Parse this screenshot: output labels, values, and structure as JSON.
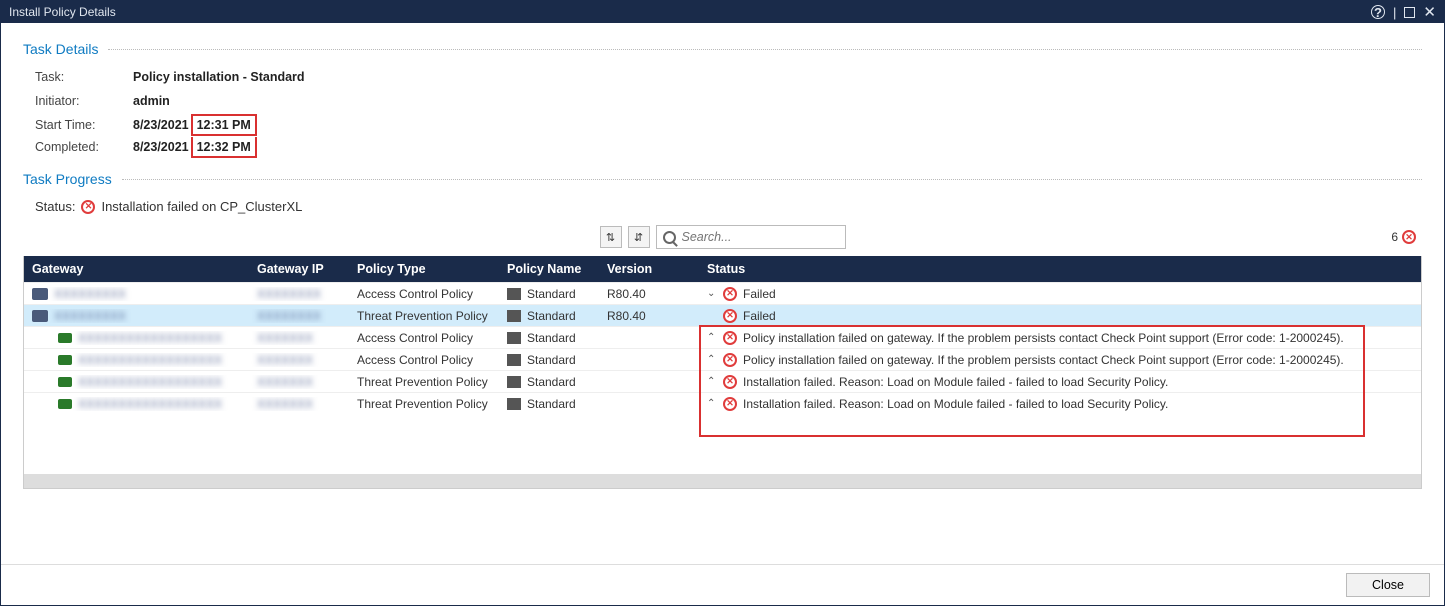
{
  "window": {
    "title": "Install Policy Details"
  },
  "sections": {
    "details_title": "Task Details",
    "progress_title": "Task Progress"
  },
  "details": {
    "task_lbl": "Task:",
    "task_val": "Policy installation - Standard",
    "initiator_lbl": "Initiator:",
    "initiator_val": "admin",
    "start_lbl": "Start Time:",
    "start_date": "8/23/2021",
    "start_time": "12:31 PM",
    "completed_lbl": "Completed:",
    "completed_date": "8/23/2021",
    "completed_time": "12:32 PM"
  },
  "progress": {
    "status_lbl": "Status:",
    "status_val": "Installation failed on CP_ClusterXL"
  },
  "toolbar": {
    "search_placeholder": "Search...",
    "count": "6"
  },
  "columns": {
    "gw": "Gateway",
    "ip": "Gateway IP",
    "pt": "Policy Type",
    "pn": "Policy Name",
    "ver": "Version",
    "stat": "Status"
  },
  "rows": [
    {
      "gw": "XXXXXXXXX",
      "ip": "XXXXXXXX",
      "pt": "Access Control Policy",
      "pn": "Standard",
      "ver": "R80.40",
      "chev": "v",
      "stat": "Failed",
      "sel": false,
      "sub": false
    },
    {
      "gw": "XXXXXXXXX",
      "ip": "XXXXXXXX",
      "pt": "Threat Prevention Policy",
      "pn": "Standard",
      "ver": "R80.40",
      "chev": "",
      "stat": "Failed",
      "sel": true,
      "sub": false
    },
    {
      "gw": "XXXXXXXXXXXXXXXXXX",
      "ip": "XXXXXXX",
      "pt": "Access Control Policy",
      "pn": "Standard",
      "ver": "",
      "chev": "^",
      "stat": "Policy installation failed on gateway. If the problem persists contact Check Point support (Error code: 1-2000245).",
      "sel": false,
      "sub": true
    },
    {
      "gw": "XXXXXXXXXXXXXXXXXX",
      "ip": "XXXXXXX",
      "pt": "Access Control Policy",
      "pn": "Standard",
      "ver": "",
      "chev": "^",
      "stat": "Policy installation failed on gateway. If the problem persists contact Check Point support (Error code: 1-2000245).",
      "sel": false,
      "sub": true
    },
    {
      "gw": "XXXXXXXXXXXXXXXXXX",
      "ip": "XXXXXXX",
      "pt": "Threat Prevention Policy",
      "pn": "Standard",
      "ver": "",
      "chev": "^",
      "stat": "Installation failed. Reason: Load on Module failed - failed to load Security Policy.",
      "sel": false,
      "sub": true
    },
    {
      "gw": "XXXXXXXXXXXXXXXXXX",
      "ip": "XXXXXXX",
      "pt": "Threat Prevention Policy",
      "pn": "Standard",
      "ver": "",
      "chev": "^",
      "stat": "Installation failed. Reason: Load on Module failed - failed to load Security Policy.",
      "sel": false,
      "sub": true
    }
  ],
  "footer": {
    "close": "Close"
  }
}
